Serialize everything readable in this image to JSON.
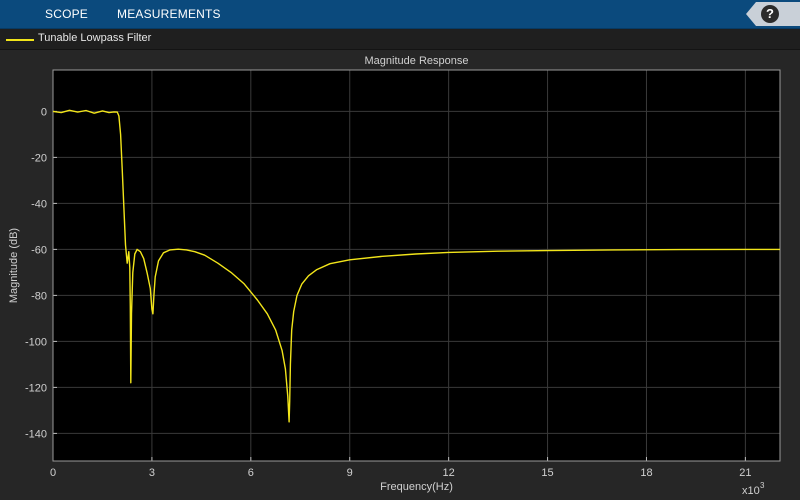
{
  "toolstrip": {
    "tabs": [
      {
        "label": "SCOPE"
      },
      {
        "label": "MEASUREMENTS"
      }
    ],
    "help_label": "?"
  },
  "legend": {
    "label": "Tunable Lowpass Filter",
    "color": "#f2e51a"
  },
  "colors": {
    "background": "#262626",
    "axes_background": "#000000",
    "grid": "#3a3a3a",
    "trace": "#f2e51a",
    "toolstrip": "#0b4a7d"
  },
  "chart_data": {
    "type": "line",
    "title": "Magnitude Response",
    "xlabel": "Frequency(Hz)",
    "ylabel": "Magnitude (dB)",
    "x_exponent_label": "x10",
    "x_exponent_power": "3",
    "xlim": [
      0,
      22050
    ],
    "ylim": [
      -152,
      18
    ],
    "grid": true,
    "x_ticks": [
      0,
      3000,
      6000,
      9000,
      12000,
      15000,
      18000,
      21000
    ],
    "x_tick_labels": [
      "0",
      "3",
      "6",
      "9",
      "12",
      "15",
      "18",
      "21"
    ],
    "y_ticks": [
      0,
      -20,
      -40,
      -60,
      -80,
      -100,
      -120,
      -140
    ],
    "y_tick_labels": [
      "0",
      "-20",
      "-40",
      "-60",
      "-80",
      "-100",
      "-120",
      "-140"
    ],
    "series": [
      {
        "name": "Tunable Lowpass Filter",
        "x": [
          0,
          250,
          500,
          750,
          1000,
          1250,
          1500,
          1700,
          1850,
          1950,
          2000,
          2050,
          2100,
          2150,
          2200,
          2250,
          2300,
          2330,
          2345,
          2360,
          2380,
          2420,
          2480,
          2550,
          2650,
          2750,
          2850,
          2950,
          3000,
          3030,
          3060,
          3100,
          3200,
          3350,
          3550,
          3800,
          4050,
          4300,
          4600,
          5000,
          5400,
          5800,
          6200,
          6500,
          6750,
          6950,
          7050,
          7120,
          7160,
          7180,
          7200,
          7240,
          7300,
          7400,
          7550,
          7750,
          8000,
          8400,
          9000,
          10000,
          11000,
          12000,
          13500,
          15000,
          17000,
          19000,
          21000,
          22050
        ],
        "y": [
          0,
          -0.5,
          0.5,
          -0.3,
          0.4,
          -0.8,
          0.2,
          -0.5,
          -0.2,
          -0.3,
          -2,
          -10,
          -25,
          -42,
          -58,
          -66,
          -61,
          -68,
          -85,
          -118,
          -88,
          -70,
          -62,
          -60,
          -61,
          -64,
          -70,
          -77,
          -86,
          -88,
          -80,
          -72,
          -65,
          -61.5,
          -60.2,
          -59.9,
          -60.2,
          -61,
          -62.5,
          -66,
          -70,
          -75,
          -82,
          -88,
          -95,
          -104,
          -112,
          -124,
          -135,
          -126,
          -110,
          -95,
          -87,
          -80,
          -75,
          -71.5,
          -68.8,
          -66.2,
          -64.5,
          -63,
          -62,
          -61.3,
          -60.8,
          -60.5,
          -60.2,
          -60.1,
          -60,
          -60
        ]
      }
    ]
  }
}
